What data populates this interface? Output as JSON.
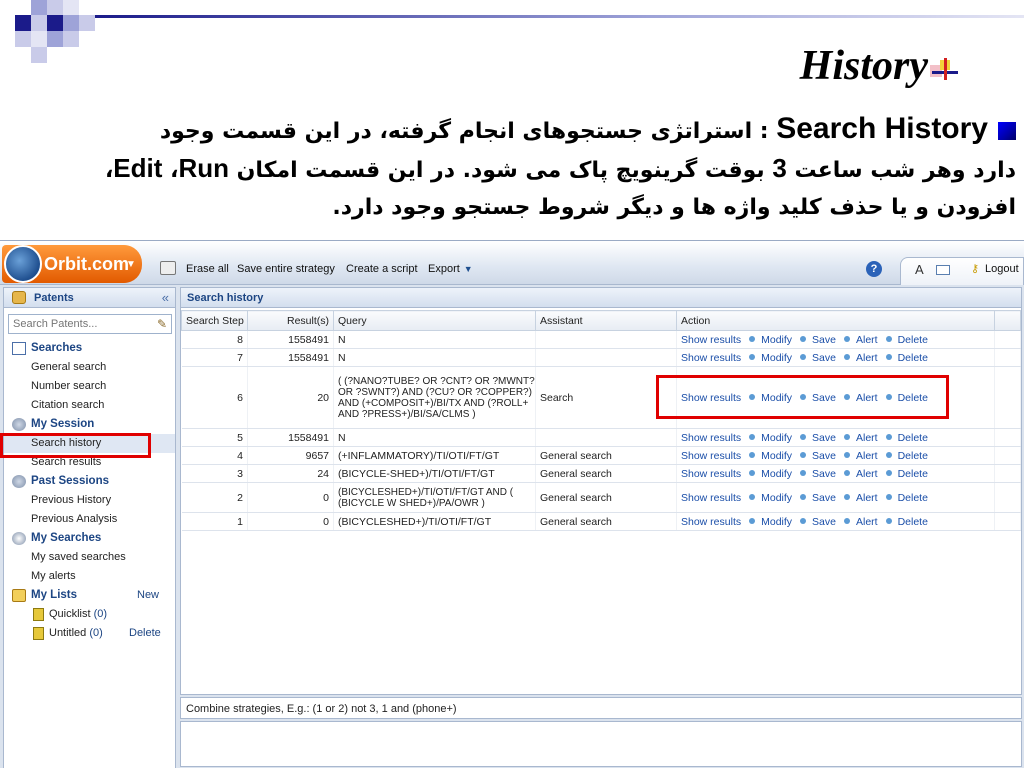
{
  "slide": {
    "title": "History",
    "paragraph_lines": [
      "Search History : استراتژی جستجوهای انجام گرفته، در این قسمت وجود",
      "دارد وهر شب ساعت 3 بوقت گرینویچ پاک می شود. در این قسمت امکان Run، Edit،",
      "افزودن و یا حذف کلید واژه ها و دیگر شروط جستجو وجود دارد."
    ],
    "heading_en": "Search History",
    "line1_rest": " : استراتژی جستجوهای انجام گرفته، در این قسمت وجود",
    "line2_a": "دارد وهر شب ساعت ",
    "line2_num": "3",
    "line2_b": " بوقت گرینویچ پاک می شود. در این قسمت امکان ",
    "line2_run": "Run",
    "line2_sep": "، ",
    "line2_edit": "Edit",
    "line2_end": "،",
    "line3": "افزودن و یا حذف کلید واژه ها و دیگر شروط جستجو وجود دارد."
  },
  "app": {
    "logo": "Orbit.com",
    "toolbar": {
      "erase_all": "Erase all",
      "save_strategy": "Save entire strategy",
      "create_script": "Create a script",
      "export": "Export",
      "logout": "Logout"
    },
    "sidebar": {
      "header": "Patents",
      "search_placeholder": "Search Patents...",
      "sections": {
        "searches": "Searches",
        "general_search": "General search",
        "number_search": "Number search",
        "citation_search": "Citation search",
        "my_session": "My Session",
        "search_history": "Search history",
        "search_results": "Search results",
        "past_sessions": "Past Sessions",
        "previous_history": "Previous History",
        "previous_analysis": "Previous Analysis",
        "my_searches": "My Searches",
        "my_saved_searches": "My saved searches",
        "my_alerts": "My alerts",
        "my_lists": "My Lists",
        "new": "New",
        "quicklist": "Quicklist",
        "quicklist_count": "(0)",
        "untitled": "Untitled",
        "untitled_count": "(0)",
        "delete": "Delete"
      }
    },
    "main": {
      "header": "Search history",
      "columns": [
        "Search Step",
        "Result(s)",
        "Query",
        "Assistant",
        "Action"
      ],
      "actions": [
        "Show results",
        "Modify",
        "Save",
        "Alert",
        "Delete"
      ],
      "rows": [
        {
          "step": "8",
          "results": "1558491",
          "query": "N",
          "assistant": ""
        },
        {
          "step": "7",
          "results": "1558491",
          "query": "N",
          "assistant": ""
        },
        {
          "step": "6",
          "results": "20",
          "query": "( (?NANO?TUBE? OR ?CNT? OR ?MWNT? OR ?SWNT?) AND (?CU? OR ?COPPER?) AND (+COMPOSIT+)/BI/TX AND (?ROLL+ AND ?PRESS+)/BI/SA/CLMS )",
          "assistant": "Search"
        },
        {
          "step": "5",
          "results": "1558491",
          "query": "N",
          "assistant": ""
        },
        {
          "step": "4",
          "results": "9657",
          "query": "(+INFLAMMATORY)/TI/OTI/FT/GT",
          "assistant": "General search"
        },
        {
          "step": "3",
          "results": "24",
          "query": "(BICYCLE-SHED+)/TI/OTI/FT/GT",
          "assistant": "General search"
        },
        {
          "step": "2",
          "results": "0",
          "query": "(BICYCLESHED+)/TI/OTI/FT/GT AND ( (BICYCLE W SHED+)/PA/OWR )",
          "assistant": "General search"
        },
        {
          "step": "1",
          "results": "0",
          "query": "(BICYCLESHED+)/TI/OTI/FT/GT",
          "assistant": "General search"
        }
      ]
    },
    "combine_hint": "Combine strategies, E.g.: (1 or 2) not 3, 1 and (phone+)"
  },
  "colors": {
    "accent_blue": "#1c4583",
    "link_blue": "#1a4ea8",
    "highlight_red": "#e00000",
    "logo_orange": "#e25a00"
  }
}
